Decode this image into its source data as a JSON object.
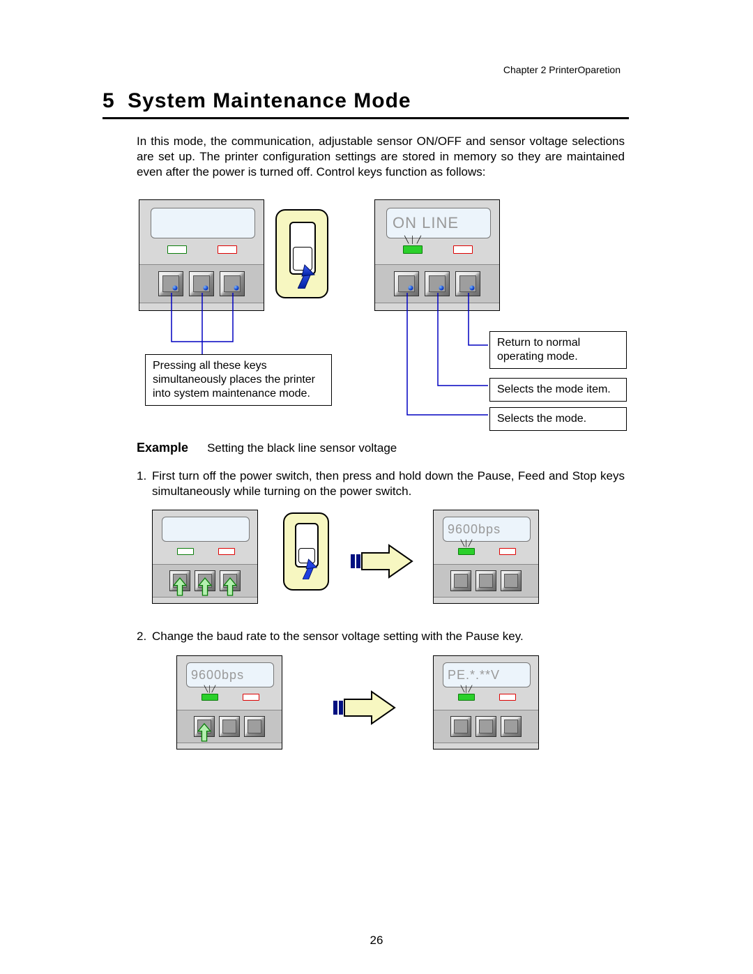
{
  "header": {
    "chapter_label": "Chapter 2    PrinterOparetion"
  },
  "section": {
    "number": "5",
    "title": "System Maintenance Mode"
  },
  "intro": "In this mode, the communication, adjustable sensor ON/OFF and sensor voltage selections are set up. The printer configuration settings are stored in memory so they are maintained even after the power is turned off. Control keys function as follows:",
  "panels": {
    "top_left_lcd": "",
    "top_right_lcd": "ON LINE",
    "step1_left_lcd": "",
    "step1_right_lcd": "9600bps",
    "step2_left_lcd": "9600bps",
    "step2_right_lcd": "PE.*.**V"
  },
  "callouts": {
    "left_box": "Pressing all these keys simultaneously places the printer into system maintenance mode.",
    "right_1": "Return to normal operating mode.",
    "right_2": "Selects the mode item.",
    "right_3": "Selects the mode."
  },
  "example": {
    "label": "Example",
    "desc": "Setting the black line sensor voltage"
  },
  "steps": {
    "s1_num": "1.",
    "s1_text": "First turn off the power switch, then press and hold down the Pause, Feed and Stop keys simultaneously while turning on the power switch.",
    "s2_num": "2.",
    "s2_text": "Change the baud rate to the sensor voltage setting with the Pause key."
  },
  "page_number": "26"
}
